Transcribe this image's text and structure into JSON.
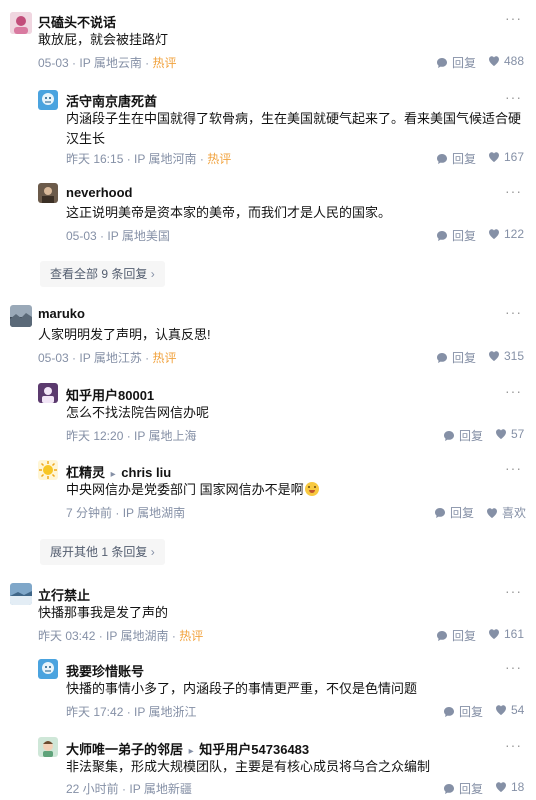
{
  "icons": {
    "more": "more-dots-icon",
    "reply": "reply-bubble-icon",
    "like": "heart-icon"
  },
  "colors": {
    "hot": "#f1a33f",
    "meta": "#8590a6",
    "text": "#121212"
  },
  "threads": [
    {
      "top": {
        "name": "只磕头不说话",
        "text": "敢放屁，就会被挂路灯",
        "date": "05-03",
        "ip": "IP 属地云南",
        "hot": "热评",
        "reply": "回复",
        "likes": "488"
      },
      "replies": [
        {
          "name": "活守南京唐死酋",
          "text": "内涵段子生在中国就得了软骨病，生在美国就硬气起来了。看来美国气候适合硬汉生长",
          "date": "昨天 16:15",
          "ip": "IP 属地河南",
          "hot": "热评",
          "reply": "回复",
          "likes": "167"
        },
        {
          "name": "neverhood",
          "text": "这正说明美帝是资本家的美帝，而我们才是人民的国家。",
          "date": "05-03",
          "ip": "IP 属地美国",
          "reply": "回复",
          "likes": "122"
        }
      ],
      "expand": "查看全部 9 条回复"
    },
    {
      "top": {
        "name": "maruko",
        "text": "人家明明发了声明，认真反思!",
        "date": "05-03",
        "ip": "IP 属地江苏",
        "hot": "热评",
        "reply": "回复",
        "likes": "315"
      },
      "replies": [
        {
          "name": "知乎用户80001",
          "text": "怎么不找法院告网信办呢",
          "date": "昨天 12:20",
          "ip": "IP 属地上海",
          "reply": "回复",
          "likes": "57"
        },
        {
          "name": "杠精灵",
          "reply_to": "chris liu",
          "text": "中央网信办是党委部门 国家网信办不是啊",
          "date": "7 分钟前",
          "ip": "IP 属地湖南",
          "reply": "回复",
          "likes": "喜欢"
        }
      ],
      "expand": "展开其他 1 条回复"
    },
    {
      "top": {
        "name": "立行禁止",
        "text": "快播那事我是发了声的",
        "date": "昨天 03:42",
        "ip": "IP 属地湖南",
        "hot": "热评",
        "reply": "回复",
        "likes": "161"
      },
      "replies": [
        {
          "name": "我要珍惜账号",
          "text": "快播的事情小多了，内涵段子的事情更严重，不仅是色情问题",
          "date": "昨天 17:42",
          "ip": "IP 属地浙江",
          "reply": "回复",
          "likes": "54"
        },
        {
          "name": "大师唯一弟子的邻居",
          "reply_to": "知乎用户54736483",
          "text": "非法聚集，形成大规模团队，主要是有核心成员将乌合之众编制",
          "date": "22 小时前",
          "ip": "IP 属地新疆",
          "reply": "回复",
          "likes": "18"
        }
      ]
    }
  ]
}
